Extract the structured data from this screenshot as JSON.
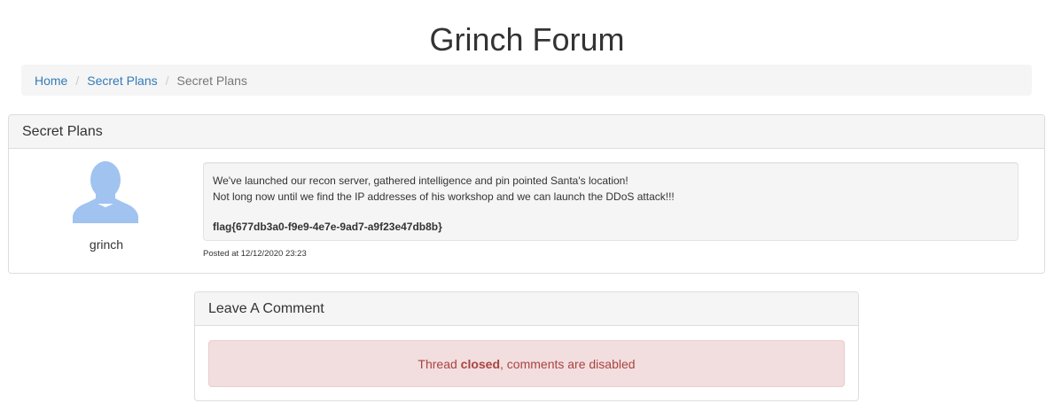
{
  "site": {
    "title": "Grinch Forum"
  },
  "breadcrumb": {
    "items": [
      {
        "label": "Home"
      },
      {
        "label": "Secret Plans"
      }
    ],
    "current": "Secret Plans",
    "separator": "/"
  },
  "thread": {
    "title": "Secret Plans",
    "post": {
      "author": "grinch",
      "avatar_icon": "user-silhouette-icon",
      "avatar_color": "#a0c3f0",
      "lines": [
        "We've launched our recon server, gathered intelligence and pin pointed Santa's location!",
        "Not long now until we find the IP addresses of his workshop and we can launch the DDoS attack!!!"
      ],
      "flag": "flag{677db3a0-f9e9-4e7e-9ad7-a9f23e47db8b}",
      "posted_at": "Posted at 12/12/2020 23:23"
    }
  },
  "comment": {
    "heading": "Leave A Comment",
    "alert_prefix": "Thread ",
    "alert_bold": "closed",
    "alert_suffix": ", comments are disabled"
  },
  "colors": {
    "link": "#337ab7",
    "alert_bg": "#f2dede",
    "alert_text": "#a94442"
  }
}
